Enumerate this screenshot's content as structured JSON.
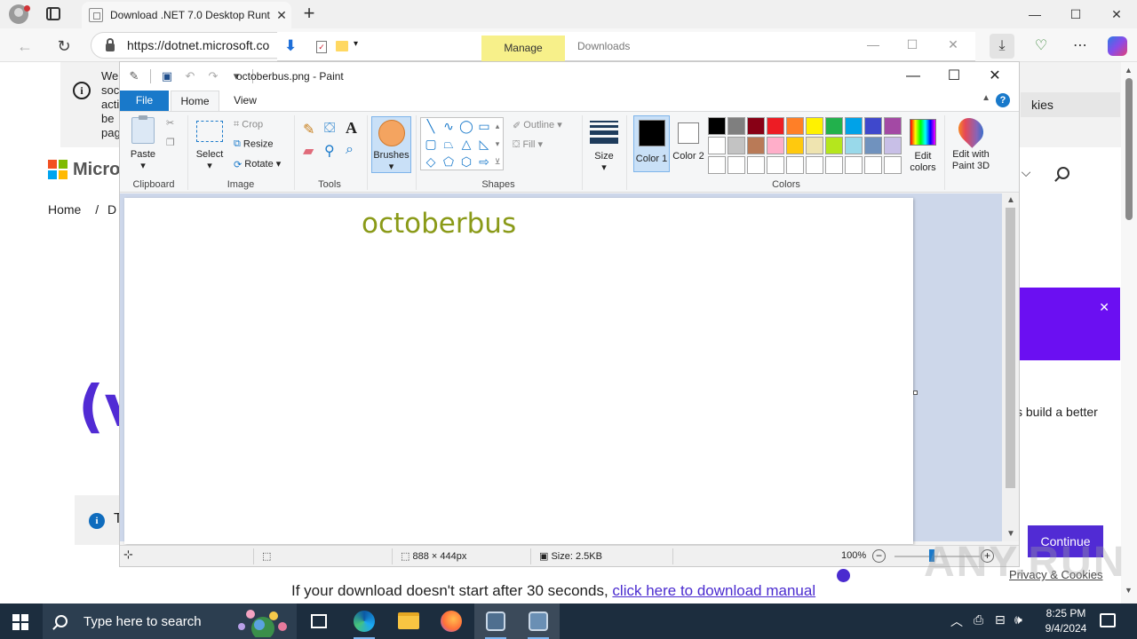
{
  "browser": {
    "tab_title": "Download .NET 7.0 Desktop Runt",
    "address": "https://dotnet.microsoft.co",
    "new_tab_symbol": "+",
    "win_min": "—",
    "win_max": "☐",
    "win_close": "✕",
    "nav_back": "←",
    "nav_reload": "↻",
    "download_symbol": "⤓",
    "more_symbol": "⋯"
  },
  "download_bar": {
    "manage_label": "Manage",
    "title": "Downloads"
  },
  "webpage": {
    "cookie_lines": [
      "We",
      "soc",
      "acti",
      "be",
      "pag"
    ],
    "cookie_button": "kies",
    "brand_fragment": "Micros",
    "breadcrumb_home": "Home",
    "breadcrumb_sep": "/",
    "breadcrumb_next": "D",
    "nav_fragment": "t ⌵",
    "brace_fragment": "(v",
    "notice_fragment": "T",
    "side_colon": ":",
    "side_text": "s build a better",
    "continue_button": "Continue",
    "privacy_link": "Privacy & Cookies",
    "download_prompt": "If your download doesn't start after 30 seconds,",
    "download_link": "click here to download manual"
  },
  "paint": {
    "title": "octoberbus.png - Paint",
    "menu": {
      "file": "File",
      "home": "Home",
      "view": "View"
    },
    "ribbon": {
      "paste": "Paste",
      "clipboard": "Clipboard",
      "select": "Select",
      "crop": "Crop",
      "resize": "Resize",
      "rotate": "Rotate",
      "image": "Image",
      "tools": "Tools",
      "brushes": "Brushes",
      "outline": "Outline",
      "fill": "Fill",
      "shapes": "Shapes",
      "size": "Size",
      "color1": "Color 1",
      "color2": "Color 2",
      "edit_colors": "Edit colors",
      "edit_paint3d": "Edit with Paint 3D",
      "colors": "Colors"
    },
    "palette": [
      "#000000",
      "#7f7f7f",
      "#880015",
      "#ed1c24",
      "#ff7f27",
      "#fff200",
      "#22b14c",
      "#00a2e8",
      "#3f48cc",
      "#a349a4",
      "#ffffff",
      "#c3c3c3",
      "#b97a57",
      "#ffaec9",
      "#ffc90e",
      "#efe4b0",
      "#b5e61d",
      "#99d9ea",
      "#7092be",
      "#c8bfe7",
      "#ffffff",
      "#ffffff",
      "#ffffff",
      "#ffffff",
      "#ffffff",
      "#ffffff",
      "#ffffff",
      "#ffffff",
      "#ffffff",
      "#ffffff"
    ],
    "color1_value": "#000000",
    "color2_value": "#ffffff",
    "canvas_text": "octoberbus",
    "canvas_text_color": "#8a9a18",
    "status": {
      "dimensions": "888 × 444px",
      "size": "Size: 2.5KB",
      "zoom": "100%"
    }
  },
  "watermark": "ANY.RUN",
  "taskbar": {
    "search_placeholder": "Type here to search",
    "time": "8:25 PM",
    "date": "9/4/2024"
  }
}
